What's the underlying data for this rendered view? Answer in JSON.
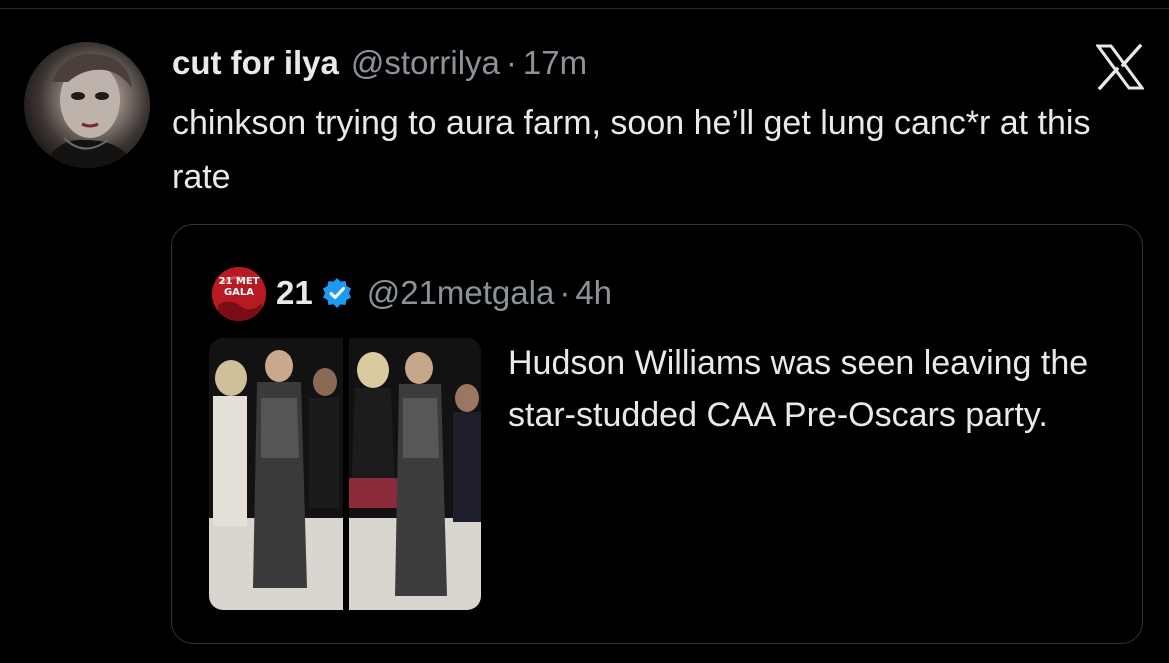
{
  "tweet": {
    "display_name": "cut for ilya",
    "handle": "@storrilya",
    "separator": "·",
    "time": "17m",
    "text": "chinkson trying to aura farm, soon he’ll get lung canc*r at this rate",
    "avatar_icon": "profile-photo",
    "platform_icon": "x-logo-icon"
  },
  "quote": {
    "avatar_text": "21 MET GALA",
    "avatar_color": "#b81a24",
    "display_name": "21",
    "verified_icon": "verified-badge-icon",
    "verified_color": "#1d9bf0",
    "handle": "@21metgala",
    "separator": "·",
    "time": "4h",
    "text": "Hudson Williams was seen leaving the star-studded CAA Pre-Oscars party.",
    "media_icon": "photo-thumbnail"
  },
  "colors": {
    "background": "#000000",
    "text_primary": "#e7e9ea",
    "text_secondary": "#8b9299",
    "border": "#2f3336"
  }
}
